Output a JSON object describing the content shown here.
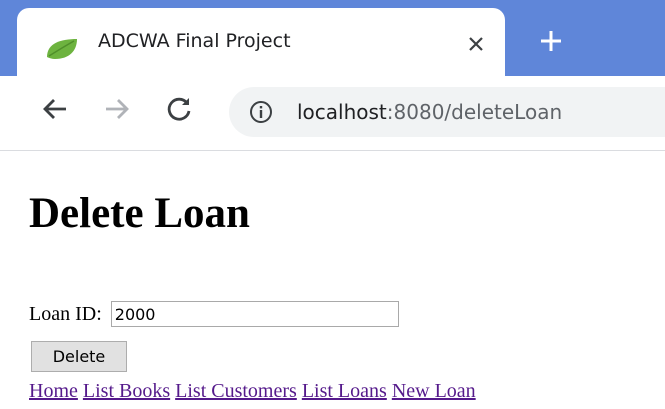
{
  "browser": {
    "tab_title": "ADCWA Final Project",
    "url_host": "localhost",
    "url_rest": ":8080/deleteLoan",
    "accent_color": "#5f86d9"
  },
  "page": {
    "heading": "Delete Loan",
    "form": {
      "loan_id_label": "Loan ID:",
      "loan_id_value": "2000",
      "delete_button_label": "Delete"
    },
    "nav_links": [
      {
        "label": "Home"
      },
      {
        "label": "List Books"
      },
      {
        "label": "List Customers"
      },
      {
        "label": "List Loans"
      },
      {
        "label": "New Loan"
      }
    ]
  }
}
